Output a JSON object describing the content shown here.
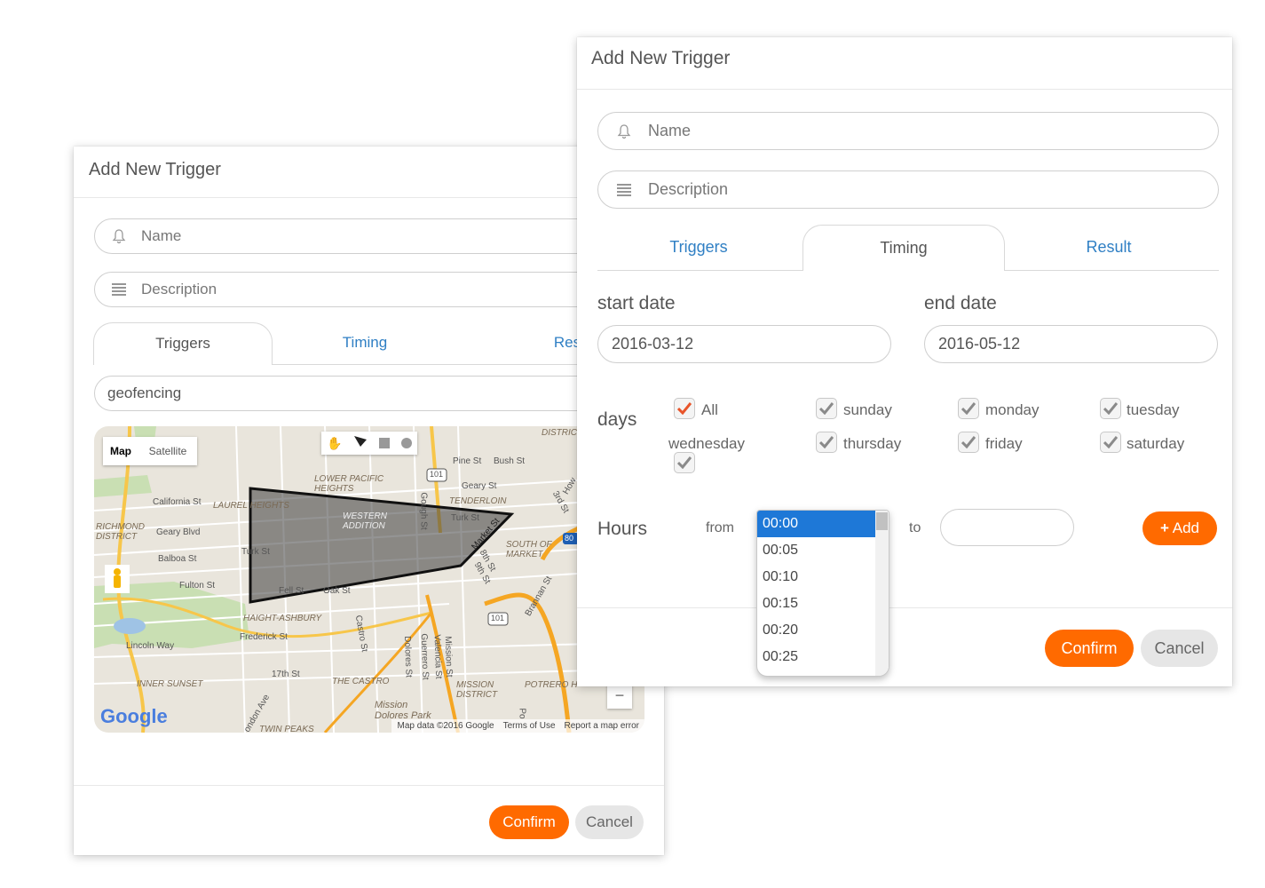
{
  "back_dialog": {
    "title": "Add New Trigger",
    "name_placeholder": "Name",
    "description_placeholder": "Description",
    "tabs": [
      {
        "label": "Triggers",
        "active": true
      },
      {
        "label": "Timing",
        "active": false
      },
      {
        "label": "Result",
        "active": false
      }
    ],
    "trigger_type_value": "geofencing",
    "map": {
      "type_buttons": [
        "Map",
        "Satellite"
      ],
      "drawing_tools": [
        "hand-icon",
        "polygon-icon",
        "rectangle-icon",
        "circle-icon"
      ],
      "zoom_out": "−",
      "logo": "Google",
      "footer": [
        "Map data ©2016 Google",
        "Terms of Use",
        "Report a map error"
      ],
      "districts": [
        "LOWER PACIFIC HEIGHTS",
        "LAUREL HEIGHTS",
        "RICHMOND DISTRICT",
        "WESTERN ADDITION",
        "TENDERLOIN",
        "SOUTH OF MARKET",
        "HAIGHT-ASHBURY",
        "INNER SUNSET",
        "THE CASTRO",
        "MISSION DISTRICT",
        "POTRERO H",
        "TWIN PEAKS",
        "Mission Dolores Park",
        "DISTRIC"
      ],
      "streets": [
        "California St",
        "Geary Blvd",
        "Balboa St",
        "Fulton St",
        "Turk St",
        "Fell St",
        "Oak St",
        "Lincoln Way",
        "Frederick St",
        "17th St",
        "Pine St",
        "Bush St",
        "Geary St",
        "Turk St",
        "Gough St",
        "Market St",
        "Castro St",
        "Dolores St",
        "Guerrero St",
        "Valencia St",
        "Mission St",
        "Brannan St",
        "8th St",
        "9th St",
        "3rd St",
        "How",
        "Po",
        "ondon Ave"
      ],
      "shields": [
        "101",
        "101",
        "80"
      ]
    },
    "confirm_label": "Confirm",
    "cancel_label": "Cancel"
  },
  "front_dialog": {
    "title": "Add New Trigger",
    "name_placeholder": "Name",
    "description_placeholder": "Description",
    "tabs": [
      {
        "label": "Triggers",
        "active": false
      },
      {
        "label": "Timing",
        "active": true
      },
      {
        "label": "Result",
        "active": false
      }
    ],
    "start_date_label": "start date",
    "start_date_value": "2016-03-12",
    "end_date_label": "end date",
    "end_date_value": "2016-05-12",
    "days_label": "days",
    "days": [
      {
        "label": "All",
        "checked": true
      },
      {
        "label": "sunday",
        "checked": true
      },
      {
        "label": "monday",
        "checked": true
      },
      {
        "label": "tuesday",
        "checked": true
      },
      {
        "label": "wednesday",
        "checked": true
      },
      {
        "label": "thursday",
        "checked": true
      },
      {
        "label": "friday",
        "checked": true
      },
      {
        "label": "saturday",
        "checked": true
      }
    ],
    "hours_label": "Hours",
    "from_label": "from",
    "to_label": "to",
    "to_value": "",
    "from_options": [
      "00:00",
      "00:05",
      "00:10",
      "00:15",
      "00:20",
      "00:25"
    ],
    "from_selected": "00:00",
    "add_label": "Add",
    "confirm_label": "Confirm",
    "cancel_label": "Cancel"
  },
  "colors": {
    "accent": "#ff6a00",
    "link": "#2f7fc4",
    "selected": "#1e78d7",
    "check_all": "#e8542a"
  }
}
